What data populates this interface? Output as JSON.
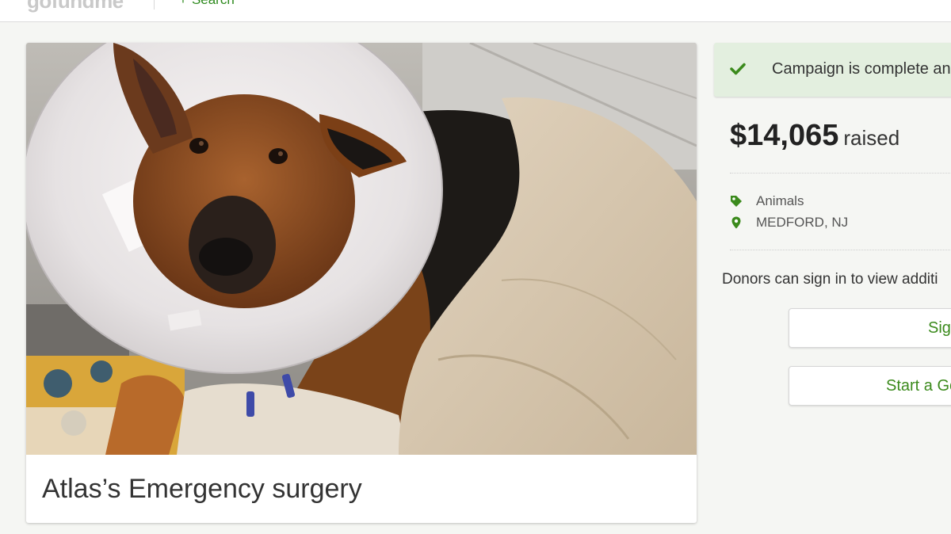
{
  "header": {
    "logo_text": "gofundme",
    "search_label": "Search",
    "search_icon": "plus-icon"
  },
  "campaign": {
    "title": "Atlas’s Emergency surgery",
    "hero_image": "german-shepherd-puppy-with-cone-and-towel"
  },
  "sidebar": {
    "status_text": "Campaign is complete and",
    "status_icon": "checkmark-icon",
    "amount": "$14,065",
    "amount_suffix": "raised",
    "category": "Animals",
    "category_icon": "tag-icon",
    "location": "MEDFORD, NJ",
    "location_icon": "map-pin-icon",
    "donors_note": "Donors can sign in to view additi",
    "sign_in_label": "Sign",
    "start_label": "Start a Go"
  },
  "colors": {
    "brand_green": "#3b8a1c",
    "status_banner_bg": "#e3efdf",
    "page_bg": "#f5f6f3"
  }
}
